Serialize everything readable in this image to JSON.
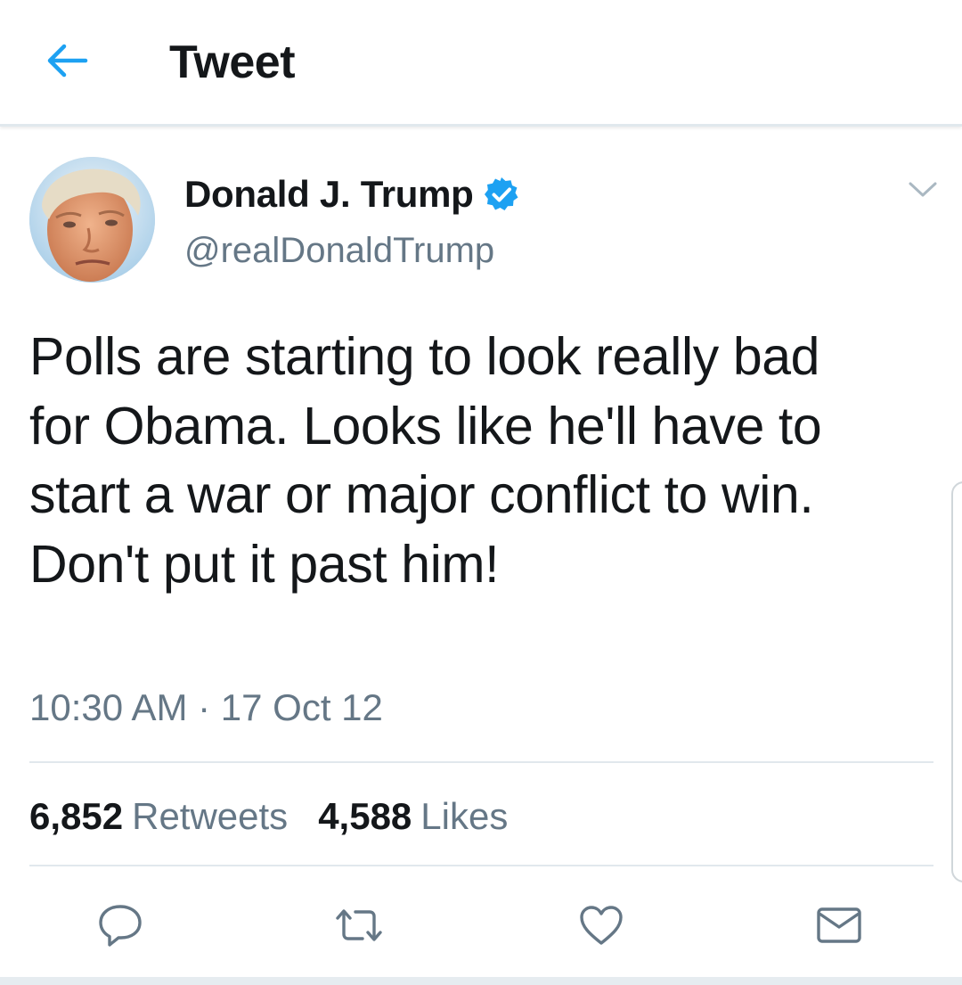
{
  "header": {
    "back_icon": "arrow-left-icon",
    "title": "Tweet"
  },
  "tweet": {
    "author": {
      "display_name": "Donald J. Trump",
      "handle": "@realDonaldTrump",
      "verified": true,
      "avatar_icon": "avatar-photo"
    },
    "text": "Polls are starting to look really bad for Obama. Looks like he'll have to start a war or major conflict to win. Don't put it past him!",
    "timestamp": "10:30 AM · 17 Oct 12",
    "stats": {
      "retweets_count": "6,852",
      "retweets_label": "Retweets",
      "likes_count": "4,588",
      "likes_label": "Likes"
    },
    "actions": [
      {
        "name": "reply",
        "icon": "speech-bubble-icon"
      },
      {
        "name": "retweet",
        "icon": "retweet-icon"
      },
      {
        "name": "like",
        "icon": "heart-icon"
      },
      {
        "name": "direct-message",
        "icon": "envelope-icon"
      }
    ]
  },
  "colors": {
    "accent": "#1da1f2",
    "text_primary": "#14171a",
    "text_secondary": "#657786",
    "divider": "#e1e8ed"
  }
}
